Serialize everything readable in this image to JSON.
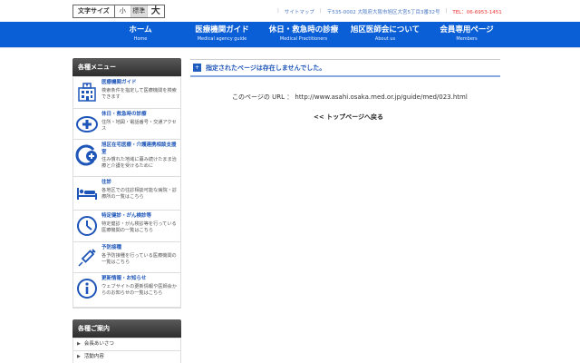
{
  "topbar": {
    "fontsize_label": "文字サイズ",
    "options": [
      "小",
      "標準",
      "大"
    ],
    "sitemap": "サイトマップ",
    "address": "〒535-0002 大阪府大阪市旭区大宮5丁目3番32号",
    "tel": "TEL：06-6953-1451"
  },
  "nav": [
    {
      "jp": "ホーム",
      "en": "Home"
    },
    {
      "jp": "医療機関ガイド",
      "en": "Medical agency guide"
    },
    {
      "jp": "休日・救急時の診療",
      "en": "Medical Practitioners"
    },
    {
      "jp": "旭区医師会について",
      "en": "About us"
    },
    {
      "jp": "会員専用ページ",
      "en": "Members"
    }
  ],
  "sidebar": {
    "title": "各種メニュー",
    "items": [
      {
        "title": "医療機関ガイド",
        "desc": "検索条件を指定して医療機関を検索できます",
        "icon": "hospital-icon"
      },
      {
        "title": "休日・救急時の診療",
        "desc": "住所・地図・電話番号・交通アクセス",
        "icon": "medical-cross-icon"
      },
      {
        "title": "旭区在宅医療・介護連携相談支援室",
        "desc": "住み慣れた地域に暮み続けたまま治療と介護を受けるために",
        "icon": "home-care-icon"
      },
      {
        "title": "往診",
        "desc": "各地区での往診相談可能な病院・診療所の一覧はこちら",
        "icon": "bed-icon"
      },
      {
        "title": "特定健診・がん検診等",
        "desc": "特定健診・がん検診等を行っている医療機関の一覧はこちら",
        "icon": "clock-icon"
      },
      {
        "title": "予防接種",
        "desc": "各予防接種を行っている医療機関の一覧はこちら",
        "icon": "syringe-icon"
      },
      {
        "title": "更新情報・お知らせ",
        "desc": "ウェブサイトの更新情報や医師会からのお知らせの一覧はこちら",
        "icon": "info-icon"
      }
    ],
    "guide_title": "各種ご案内",
    "guide_items": [
      "会長あいさつ",
      "活動内容"
    ]
  },
  "main": {
    "alert": "指定されたページは存在しませんでした。",
    "url_label": "このページの URL ： http://www.asahi.osaka.med.or.jp/guide/med/023.html",
    "back_link": "<< トップページへ戻る"
  },
  "colors": {
    "nav_bg": "#0b5fd6",
    "link": "#1e55b8",
    "sidebar_head": "#3a3a3a"
  }
}
